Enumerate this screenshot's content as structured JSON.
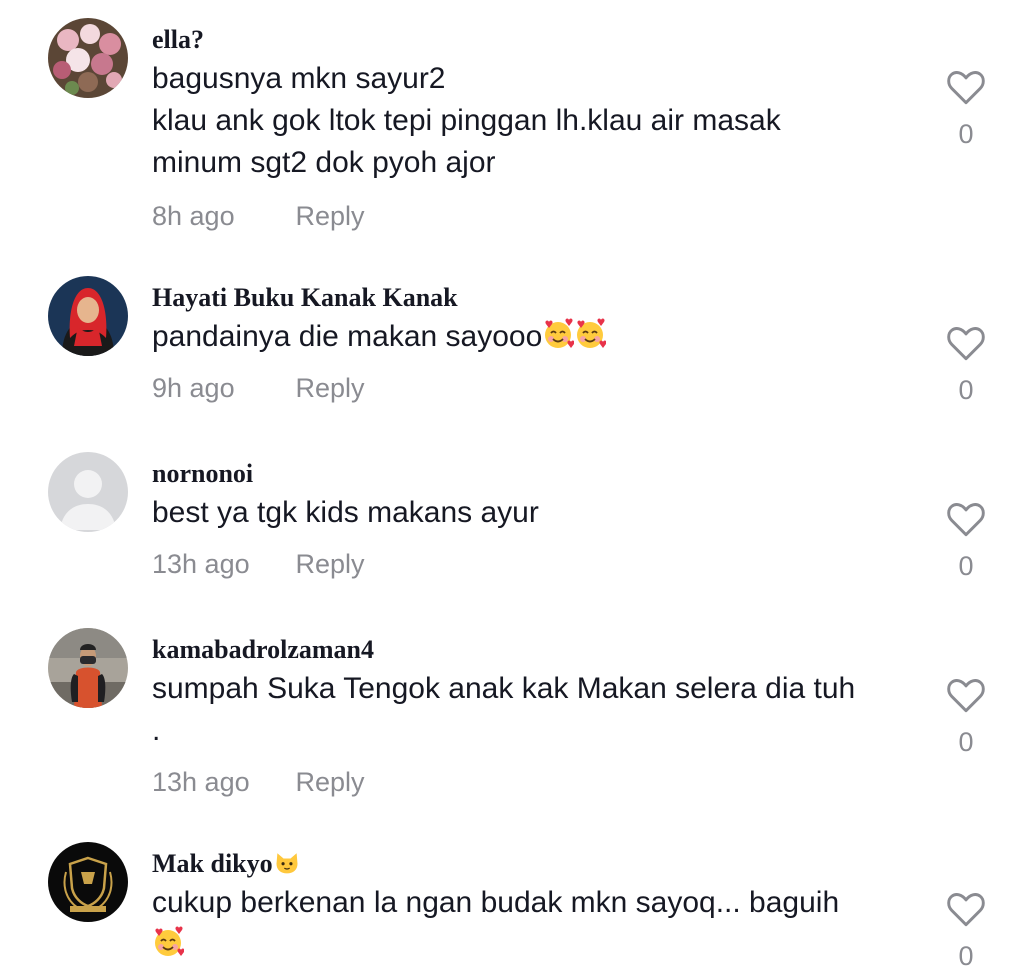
{
  "comments": [
    {
      "username": "ella?",
      "lines": [
        "bagusnya mkn sayur2",
        "klau ank gok ltok tepi pinggan lh.klau air masak",
        "minum sgt2 dok pyoh ajor"
      ],
      "time": "8h ago",
      "reply": "Reply",
      "likes": "0",
      "avatar_icon": "flower-bouquet-avatar"
    },
    {
      "username": "Hayati Buku Kanak Kanak",
      "lines": [
        "pandainya die makan sayooo"
      ],
      "time": "9h ago",
      "reply": "Reply",
      "likes": "0",
      "avatar_icon": "hijab-woman-avatar",
      "emoji": "smiling-face-with-hearts"
    },
    {
      "username": "nornonoi",
      "lines": [
        "best ya tgk kids makans ayur"
      ],
      "time": "13h ago",
      "reply": "Reply",
      "likes": "0",
      "avatar_icon": "default-user-avatar"
    },
    {
      "username": "kamabadrolzaman4",
      "lines": [
        "sumpah Suka Tengok anak kak Makan selera dia tuh",
        "."
      ],
      "time": "13h ago",
      "reply": "Reply",
      "likes": "0",
      "avatar_icon": "man-in-mask-avatar"
    },
    {
      "username": "Mak dikyo",
      "lines": [
        "cukup berkenan la ngan budak mkn sayoq... baguih"
      ],
      "time": "",
      "reply": "",
      "likes": "0",
      "avatar_icon": "kedah-crest-avatar",
      "name_emoji": "cat-face",
      "emoji": "smiling-face-with-hearts"
    }
  ],
  "colors": {
    "text": "#161823",
    "muted": "#8a8b91",
    "heart_outline": "#8a8b91"
  }
}
